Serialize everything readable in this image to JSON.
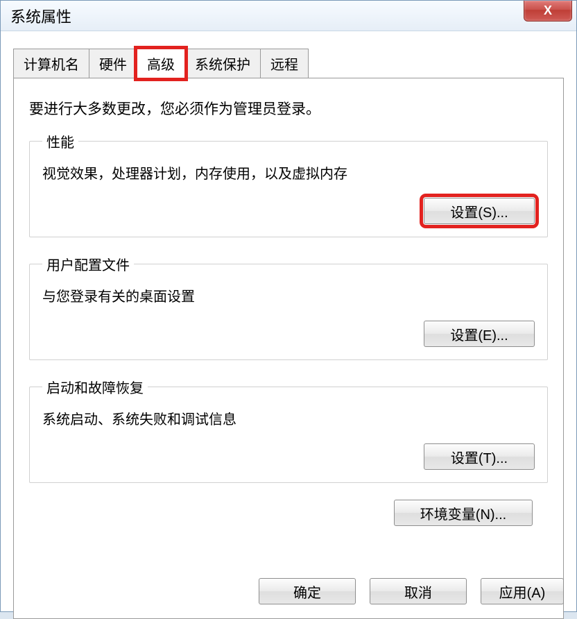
{
  "window": {
    "title": "系统属性",
    "close_label": "X"
  },
  "tabs": {
    "computer_name": "计算机名",
    "hardware": "硬件",
    "advanced": "高级",
    "system_protection": "系统保护",
    "remote": "远程"
  },
  "advanced_panel": {
    "admin_note": "要进行大多数更改，您必须作为管理员登录。",
    "performance": {
      "legend": "性能",
      "desc": "视觉效果，处理器计划，内存使用，以及虚拟内存",
      "settings_btn": "设置(S)..."
    },
    "user_profiles": {
      "legend": "用户配置文件",
      "desc": "与您登录有关的桌面设置",
      "settings_btn": "设置(E)..."
    },
    "startup_recovery": {
      "legend": "启动和故障恢复",
      "desc": "系统启动、系统失败和调试信息",
      "settings_btn": "设置(T)..."
    },
    "env_vars_btn": "环境变量(N)..."
  },
  "footer": {
    "ok": "确定",
    "cancel": "取消",
    "apply": "应用(A)"
  }
}
